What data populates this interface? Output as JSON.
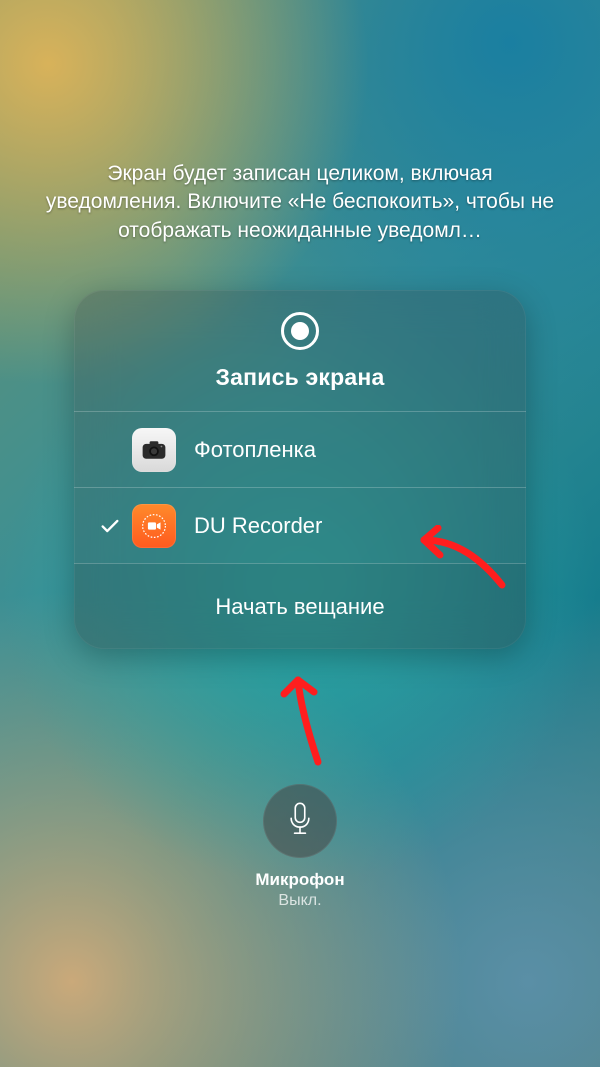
{
  "hint_text": "Экран будет записан целиком, включая уведомления. Включите «Не беспокоить», чтобы не отображать неожиданные уведомл…",
  "panel": {
    "title": "Запись экрана",
    "options": [
      {
        "label": "Фотопленка",
        "selected": false
      },
      {
        "label": "DU Recorder",
        "selected": true
      }
    ],
    "action": "Начать вещание"
  },
  "microphone": {
    "title": "Микрофон",
    "state": "Выкл."
  }
}
